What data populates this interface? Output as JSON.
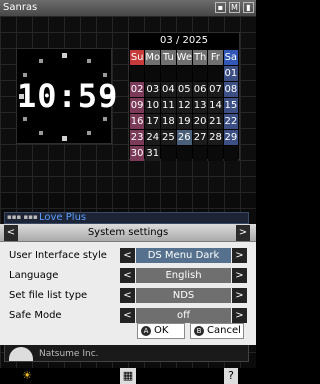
{
  "top": {
    "user_name": "Sanras",
    "status_icons": [
      {
        "name": "sd-card-icon",
        "glyph": "▪"
      },
      {
        "name": "memory-icon",
        "glyph": "M"
      },
      {
        "name": "battery-icon",
        "glyph": "▮"
      }
    ],
    "clock": {
      "time": "10:59"
    },
    "calendar": {
      "month_label": "03 / 2025",
      "weekdays": [
        "Su",
        "Mo",
        "Tu",
        "We",
        "Th",
        "Fr",
        "Sa"
      ],
      "weeks": [
        [
          "",
          "",
          "",
          "",
          "",
          "",
          "01"
        ],
        [
          "02",
          "03",
          "04",
          "05",
          "06",
          "07",
          "08"
        ],
        [
          "09",
          "10",
          "11",
          "12",
          "13",
          "14",
          "15"
        ],
        [
          "16",
          "17",
          "18",
          "19",
          "20",
          "21",
          "22"
        ],
        [
          "23",
          "24",
          "25",
          "26",
          "27",
          "28",
          "29"
        ],
        [
          "30",
          "31",
          "",
          "",
          "",
          "",
          ""
        ]
      ],
      "today": "26",
      "colors": {
        "sunday": "#c63a3a",
        "saturday": "#3158b8",
        "today": "#4a5f7a"
      }
    }
  },
  "bottom": {
    "background_title": {
      "tag": "▪▪▪ ▪▪▪",
      "title": "Love Plus"
    },
    "background_footer": {
      "name": "Natsume Inc."
    },
    "dialog": {
      "title": "System settings",
      "nav_prev": "<",
      "nav_next": ">",
      "rows": [
        {
          "label": "User Interface style",
          "value": "DS Menu Dark",
          "selected": true
        },
        {
          "label": "Language",
          "value": "English",
          "selected": false
        },
        {
          "label": "Set file list type",
          "value": "NDS",
          "selected": false
        },
        {
          "label": "Safe Mode",
          "value": "off",
          "selected": false
        }
      ],
      "arrow_left": "<",
      "arrow_right": ">",
      "ok": {
        "badge": "A",
        "label": "OK"
      },
      "cancel": {
        "badge": "B",
        "label": "Cancel"
      }
    },
    "bar": {
      "brightness_icon": "☀",
      "settings_icon": "▦",
      "help_icon": "?"
    }
  }
}
